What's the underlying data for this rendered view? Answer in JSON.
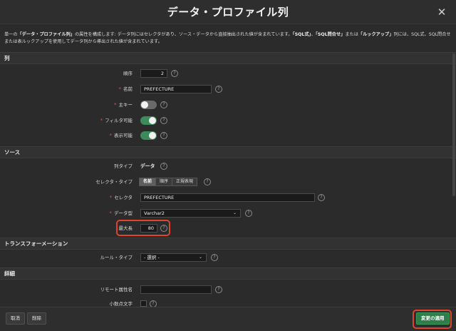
{
  "dialog": {
    "title": "データ・プロファイル列",
    "close_glyph": "✕"
  },
  "intro": {
    "p1": "単一の",
    "b1": "「データ・プロファイル列」",
    "p2": "の属性を構成します: データ列にはセレクタがあり、ソース・データから直接抽出された値が含まれています。",
    "b2": "「SQL式」",
    "p3": "、",
    "b3": "「SQL問合せ」",
    "p4": "または",
    "b4": "「ルックアップ」",
    "p5": "列には、SQL式、SQL問合せまたは表ルックアップを使用してデータ列から導出された値が含まれています。"
  },
  "sections": {
    "column": "列",
    "source": "ソース",
    "transformation": "トランスフォーメーション",
    "details": "詳細"
  },
  "column": {
    "order_label": "順序",
    "order_value": "2",
    "name_label": "名前",
    "name_value": "PREFECTURE",
    "pk_label": "主キー",
    "pk_on": false,
    "filterable_label": "フィルタ可能",
    "filterable_on": true,
    "visible_label": "表示可能",
    "visible_on": true
  },
  "source": {
    "column_type_label": "列タイプ",
    "column_type_value": "データ",
    "selector_type_label": "セレクタ・タイプ",
    "selector_types": [
      "名前",
      "順序",
      "正規表現"
    ],
    "selector_label": "セレクタ",
    "selector_value": "PREFECTURE",
    "data_type_label": "データ型",
    "data_type_value": "Varchar2",
    "max_length_label": "最大長",
    "max_length_value": "80"
  },
  "transformation": {
    "rule_type_label": "ルール・タイプ",
    "rule_type_value": "- 選択 -"
  },
  "details": {
    "remote_attr_label": "リモート属性名",
    "remote_attr_value": "",
    "decimal_char_label": "小数点文字"
  },
  "footer": {
    "cancel_label": "取消",
    "delete_label": "削除",
    "apply_label": "変更の適用"
  },
  "colors": {
    "accent_green": "#2f7d4a",
    "highlight_red": "#e0442c",
    "required_red": "#d9534f"
  },
  "icons": {
    "help": "?",
    "chevron": "⌄"
  }
}
